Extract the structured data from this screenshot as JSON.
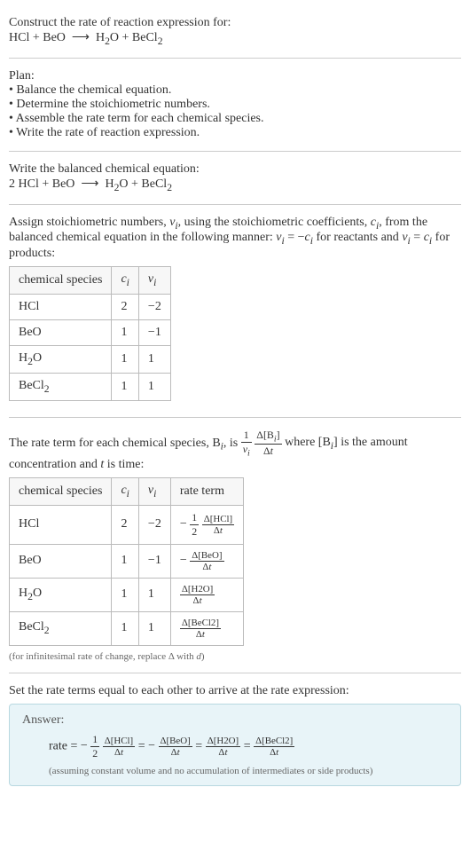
{
  "header": {
    "prompt": "Construct the rate of reaction expression for:",
    "equation_html": "HCl + BeO &nbsp;⟶&nbsp; H<sub>2</sub>O + BeCl<sub>2</sub>"
  },
  "plan": {
    "title": "Plan:",
    "items": [
      "Balance the chemical equation.",
      "Determine the stoichiometric numbers.",
      "Assemble the rate term for each chemical species.",
      "Write the rate of reaction expression."
    ]
  },
  "balanced": {
    "title": "Write the balanced chemical equation:",
    "equation_html": "2 HCl + BeO &nbsp;⟶&nbsp; H<sub>2</sub>O + BeCl<sub>2</sub>"
  },
  "stoich": {
    "intro_html": "Assign stoichiometric numbers, <i>ν<sub>i</sub></i>, using the stoichiometric coefficients, <i>c<sub>i</sub></i>, from the balanced chemical equation in the following manner: <i>ν<sub>i</sub></i> = −<i>c<sub>i</sub></i> for reactants and <i>ν<sub>i</sub></i> = <i>c<sub>i</sub></i> for products:",
    "headers": [
      "chemical species",
      "c_i",
      "ν_i"
    ],
    "rows": [
      {
        "species_html": "HCl",
        "c": "2",
        "nu": "−2"
      },
      {
        "species_html": "BeO",
        "c": "1",
        "nu": "−1"
      },
      {
        "species_html": "H<sub>2</sub>O",
        "c": "1",
        "nu": "1"
      },
      {
        "species_html": "BeCl<sub>2</sub>",
        "c": "1",
        "nu": "1"
      }
    ]
  },
  "rate_term": {
    "intro_pre": "The rate term for each chemical species, B",
    "intro_mid": ", is ",
    "intro_post_html": " where [B<sub><i>i</i></sub>] is the amount concentration and <i>t</i> is time:",
    "headers": [
      "chemical species",
      "c_i",
      "ν_i",
      "rate term"
    ],
    "rows": [
      {
        "species_html": "HCl",
        "c": "2",
        "nu": "−2",
        "rate_prefix": "−",
        "rate_coef_num": "1",
        "rate_coef_den": "2",
        "rate_num": "Δ[HCl]",
        "rate_den": "Δt"
      },
      {
        "species_html": "BeO",
        "c": "1",
        "nu": "−1",
        "rate_prefix": "−",
        "rate_coef_num": "",
        "rate_coef_den": "",
        "rate_num": "Δ[BeO]",
        "rate_den": "Δt"
      },
      {
        "species_html": "H<sub>2</sub>O",
        "c": "1",
        "nu": "1",
        "rate_prefix": "",
        "rate_coef_num": "",
        "rate_coef_den": "",
        "rate_num": "Δ[H2O]",
        "rate_den": "Δt"
      },
      {
        "species_html": "BeCl<sub>2</sub>",
        "c": "1",
        "nu": "1",
        "rate_prefix": "",
        "rate_coef_num": "",
        "rate_coef_den": "",
        "rate_num": "Δ[BeCl2]",
        "rate_den": "Δt"
      }
    ],
    "note_html": "(for infinitesimal rate of change, replace Δ with <i>d</i>)"
  },
  "final": {
    "title": "Set the rate terms equal to each other to arrive at the rate expression:",
    "answer_label": "Answer:",
    "rate_label": "rate = ",
    "terms": [
      {
        "prefix": "−",
        "coef_num": "1",
        "coef_den": "2",
        "num": "Δ[HCl]",
        "den": "Δt"
      },
      {
        "prefix": "−",
        "coef_num": "",
        "coef_den": "",
        "num": "Δ[BeO]",
        "den": "Δt"
      },
      {
        "prefix": "",
        "coef_num": "",
        "coef_den": "",
        "num": "Δ[H2O]",
        "den": "Δt"
      },
      {
        "prefix": "",
        "coef_num": "",
        "coef_den": "",
        "num": "Δ[BeCl2]",
        "den": "Δt"
      }
    ],
    "assumption": "(assuming constant volume and no accumulation of intermediates or side products)"
  }
}
